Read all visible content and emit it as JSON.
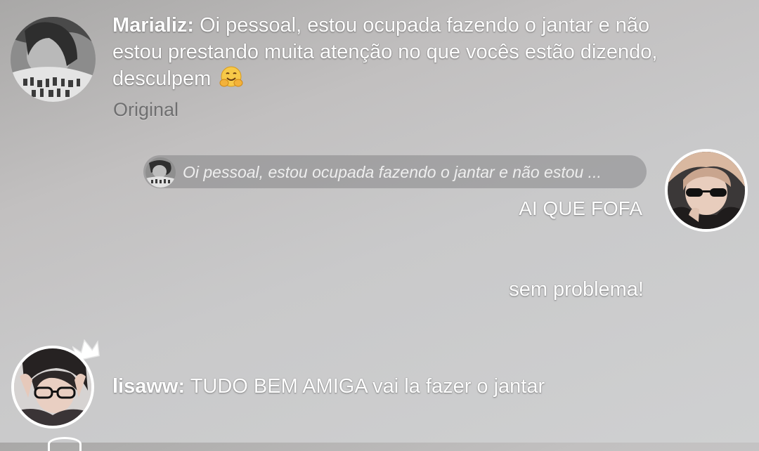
{
  "messages": [
    {
      "author": "Marializ:",
      "text": "Oi pessoal, estou ocupada fazendo o jantar e não estou prestando muita atenção no que vocês estão dizendo, desculpem",
      "emoji": "hugging-face-emoji",
      "original_label": "Original"
    }
  ],
  "reply": {
    "quote_text": "Oi pessoal, estou ocupada fazendo o jantar e não estou ...",
    "text": "AI QUE FOFA"
  },
  "followup": {
    "text": "sem problema!"
  },
  "last_message": {
    "author": "lisaww:",
    "text": "TUDO BEM AMIGA vai la fazer o jantar",
    "badge_icon": "crown-icon"
  },
  "colors": {
    "message_text": "#ffffff",
    "original_label": "#6f6f70",
    "quote_bg": "#8a8a8c",
    "avatar_border": "#ffffff"
  }
}
